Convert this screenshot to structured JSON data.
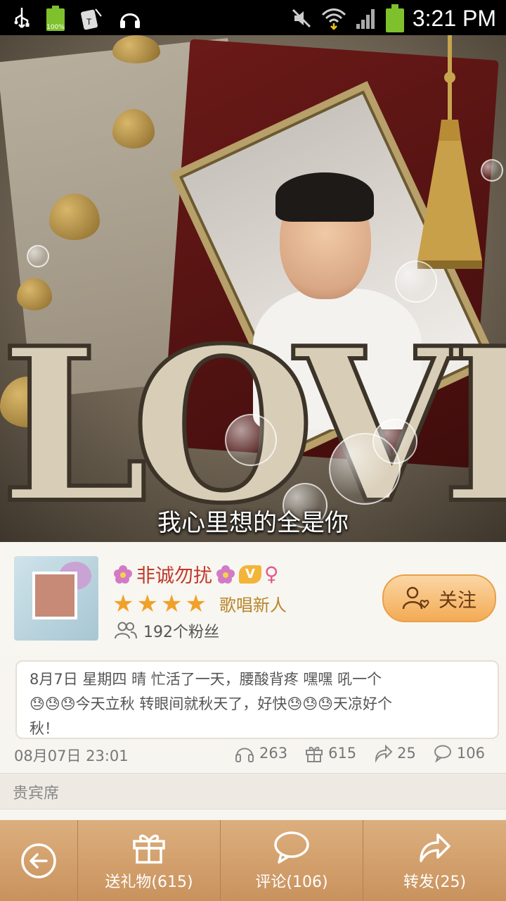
{
  "status_bar": {
    "time": "3:21 PM",
    "battery_left_label": "100%",
    "icons": [
      "usb-icon",
      "battery-icon",
      "sim-icon",
      "headphones-icon",
      "mute-icon",
      "wifi-icon",
      "signal-icon",
      "battery-full-icon"
    ]
  },
  "hero": {
    "caption": "我心里想的全是你",
    "overlay_word": "LOVE"
  },
  "profile": {
    "name": "非诚勿扰",
    "vip_badge": "V",
    "gender_symbol": "♀",
    "stars": 4,
    "level_title": "歌唱新人",
    "fans": "192个粉丝",
    "follow_label": "关注"
  },
  "post": {
    "text_line1": "8月7日 星期四 晴 忙活了一天，腰酸背疼 嘿嘿 吼一个",
    "text_line2": "😓😓😓今天立秋 转眼间就秋天了，好快😓😓😓天凉好个",
    "text_line3": "秋！",
    "date": "08月07日 23:01",
    "listens": "263",
    "gifts": "615",
    "shares": "25",
    "comments": "106"
  },
  "guest_section": {
    "label": "贵宾席"
  },
  "bottom_nav": {
    "gift_label": "送礼物(615)",
    "comment_label": "评论(106)",
    "share_label": "转发(25)"
  },
  "colors": {
    "accent_orange": "#f3ab55",
    "nav_brown": "#c9925d",
    "name_red": "#c0392b"
  }
}
